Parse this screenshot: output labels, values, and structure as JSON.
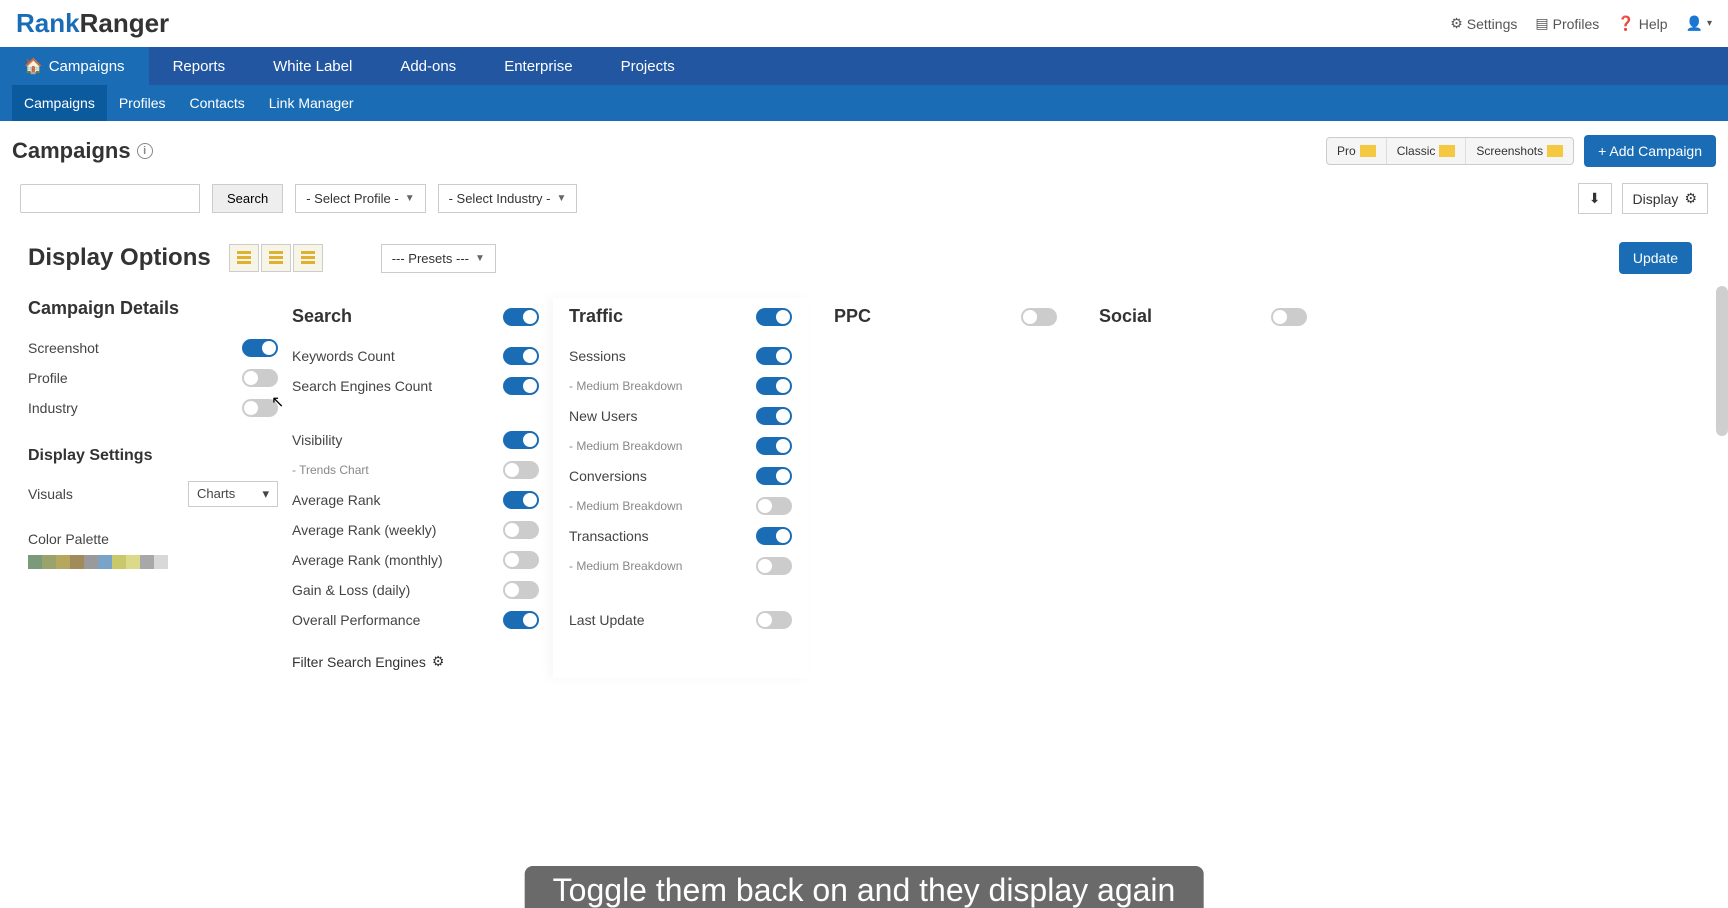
{
  "brand": {
    "part1": "Rank",
    "part2": "Ranger"
  },
  "topLinks": {
    "settings": "Settings",
    "profiles": "Profiles",
    "help": "Help"
  },
  "nav1": [
    "Campaigns",
    "Reports",
    "White Label",
    "Add-ons",
    "Enterprise",
    "Projects"
  ],
  "nav2": [
    "Campaigns",
    "Profiles",
    "Contacts",
    "Link Manager"
  ],
  "pageTitle": "Campaigns",
  "viewModes": [
    "Pro",
    "Classic",
    "Screenshots"
  ],
  "addCampaign": "+ Add Campaign",
  "searchBtn": "Search",
  "selectProfile": "- Select Profile -",
  "selectIndustry": "- Select Industry -",
  "displayBtn": "Display",
  "displayOptionsTitle": "Display Options",
  "presets": "--- Presets ---",
  "updateBtn": "Update",
  "campaignDetails": {
    "title": "Campaign Details",
    "rows": [
      {
        "label": "Screenshot",
        "on": true
      },
      {
        "label": "Profile",
        "on": false
      },
      {
        "label": "Industry",
        "on": false
      }
    ]
  },
  "displaySettings": {
    "title": "Display Settings",
    "visualsLabel": "Visuals",
    "visualsValue": "Charts",
    "paletteLabel": "Color Palette",
    "palette": [
      "#7a9a7a",
      "#9aa36b",
      "#b5a85e",
      "#a28b5a",
      "#9a9a9a",
      "#7aa3c9",
      "#c9c96b",
      "#dada8a",
      "#a8a8a8",
      "#d8d8d8"
    ]
  },
  "search": {
    "title": "Search",
    "on": true,
    "rows": [
      {
        "label": "Keywords Count",
        "on": true
      },
      {
        "label": "Search Engines Count",
        "on": true
      },
      {
        "label": "Visibility",
        "on": true,
        "gap": true
      },
      {
        "label": "Trends Chart",
        "on": false,
        "sub": true
      },
      {
        "label": "Average Rank",
        "on": true
      },
      {
        "label": "Average Rank (weekly)",
        "on": false
      },
      {
        "label": "Average Rank (monthly)",
        "on": false
      },
      {
        "label": "Gain & Loss (daily)",
        "on": false
      },
      {
        "label": "Overall Performance",
        "on": true
      }
    ],
    "filterLabel": "Filter Search Engines"
  },
  "traffic": {
    "title": "Traffic",
    "on": true,
    "rows": [
      {
        "label": "Sessions",
        "on": true
      },
      {
        "label": "Medium Breakdown",
        "on": true,
        "sub": true
      },
      {
        "label": "New Users",
        "on": true
      },
      {
        "label": "Medium Breakdown",
        "on": true,
        "sub": true
      },
      {
        "label": "Conversions",
        "on": true
      },
      {
        "label": "Medium Breakdown",
        "on": false,
        "sub": true
      },
      {
        "label": "Transactions",
        "on": true
      },
      {
        "label": "Medium Breakdown",
        "on": false,
        "sub": true
      },
      {
        "label": "Last Update",
        "on": false,
        "gap": true
      }
    ]
  },
  "ppc": {
    "title": "PPC",
    "on": false
  },
  "social": {
    "title": "Social",
    "on": false
  },
  "caption": "Toggle them back on and they display again"
}
